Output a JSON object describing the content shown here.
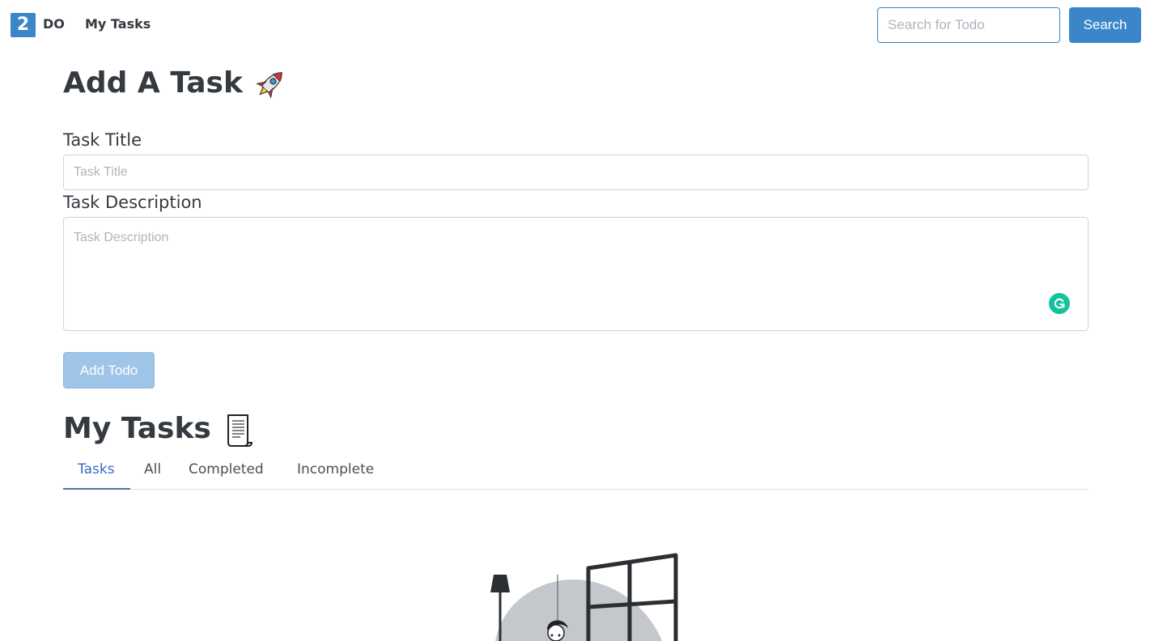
{
  "navbar": {
    "logo_text": "2",
    "brand_text": "DO",
    "nav_link": "My Tasks",
    "search": {
      "placeholder": "Search for Todo",
      "value": ""
    },
    "search_button": "Search"
  },
  "add_task": {
    "heading": "Add A Task",
    "heading_icon": "rocket-icon",
    "title_label": "Task Title",
    "title_placeholder": "Task Title",
    "title_value": "",
    "description_label": "Task Description",
    "description_placeholder": "Task Description",
    "description_value": "",
    "add_button": "Add Todo"
  },
  "my_tasks": {
    "heading": "My Tasks",
    "heading_icon": "scroll-icon",
    "tabs": [
      {
        "label": "Tasks",
        "active": true
      },
      {
        "label": "All",
        "active": false
      },
      {
        "label": "Completed",
        "active": false
      },
      {
        "label": "Incomplete",
        "active": false
      }
    ]
  },
  "colors": {
    "primary": "#3a86c8",
    "disabled_button": "#9fc5e8",
    "grammarly": "#15c39a",
    "text": "#343a40"
  }
}
